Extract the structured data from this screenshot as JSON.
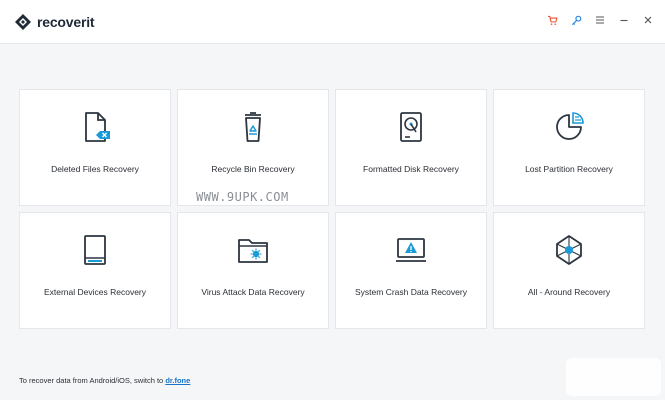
{
  "app": {
    "name": "recoverit"
  },
  "window_controls": [
    {
      "name": "cart-icon"
    },
    {
      "name": "key-icon"
    },
    {
      "name": "menu-icon"
    },
    {
      "name": "minimize-icon"
    },
    {
      "name": "close-icon"
    }
  ],
  "cards": [
    {
      "label": "Deleted Files Recovery",
      "icon": "deleted-file-icon"
    },
    {
      "label": "Recycle Bin Recovery",
      "icon": "recycle-bin-icon"
    },
    {
      "label": "Formatted Disk Recovery",
      "icon": "hard-disk-icon"
    },
    {
      "label": "Lost Partition Recovery",
      "icon": "partition-pie-icon"
    },
    {
      "label": "External Devices Recovery",
      "icon": "external-device-icon"
    },
    {
      "label": "Virus Attack Data Recovery",
      "icon": "virus-folder-icon"
    },
    {
      "label": "System Crash Data Recovery",
      "icon": "crash-monitor-icon"
    },
    {
      "label": "All - Around Recovery",
      "icon": "all-around-icon"
    }
  ],
  "watermark": "WWW.9UPK.COM",
  "footer": {
    "text": "To recover data from Android/iOS, switch to ",
    "link": "dr.fone"
  },
  "colors": {
    "accent": "#1a73c8",
    "cart": "#e8532f",
    "key": "#2b86d9",
    "icon_stroke": "#2d3540"
  }
}
